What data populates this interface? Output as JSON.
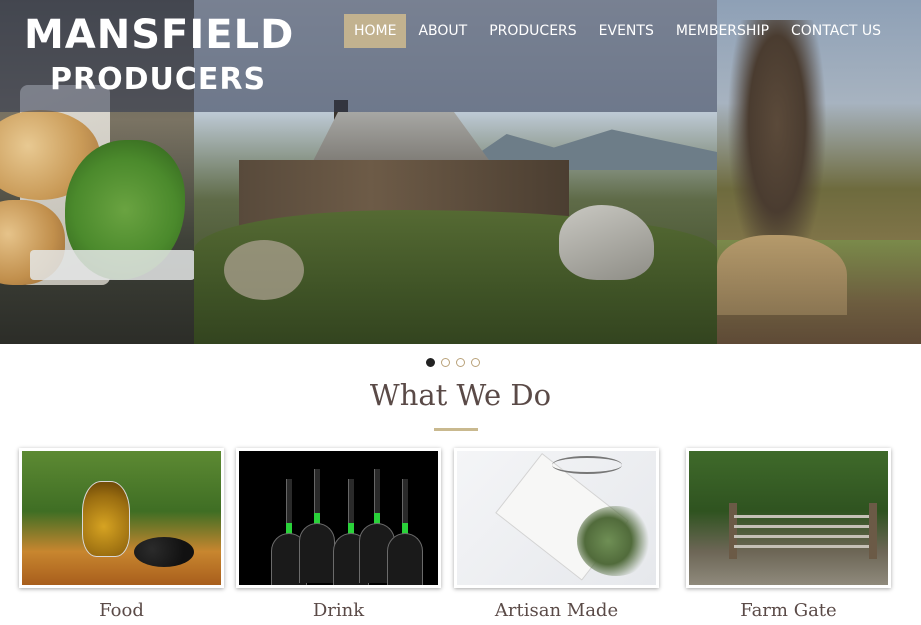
{
  "logo": {
    "line1": "MANSFIELD",
    "line2": "PRODUCERS"
  },
  "nav": {
    "items": [
      {
        "label": "HOME"
      },
      {
        "label": "ABOUT"
      },
      {
        "label": "PRODUCERS"
      },
      {
        "label": "EVENTS"
      },
      {
        "label": "MEMBERSHIP"
      },
      {
        "label": "CONTACT US"
      }
    ],
    "active_index": 0
  },
  "slider": {
    "slide_count": 4,
    "active_slide": 1
  },
  "section": {
    "title": "What We Do"
  },
  "cards": [
    {
      "label": "Food",
      "image": "olive-oil-bottle-with-olives"
    },
    {
      "label": "Drink",
      "image": "wine-bottles-silhouette"
    },
    {
      "label": "Artisan Made",
      "image": "gift-envelope-with-ribbon"
    },
    {
      "label": "Farm Gate",
      "image": "wooden-farm-gate"
    }
  ],
  "hero": {
    "panels": [
      "bread-and-herbs",
      "mountain-hut",
      "rural-field-with-tree"
    ]
  },
  "colors": {
    "nav_active_bg": "#c2b28f",
    "accent_rule": "#c9b98f",
    "heading_text": "#5a4a47",
    "header_overlay": "rgba(45,55,80,0.55)"
  }
}
